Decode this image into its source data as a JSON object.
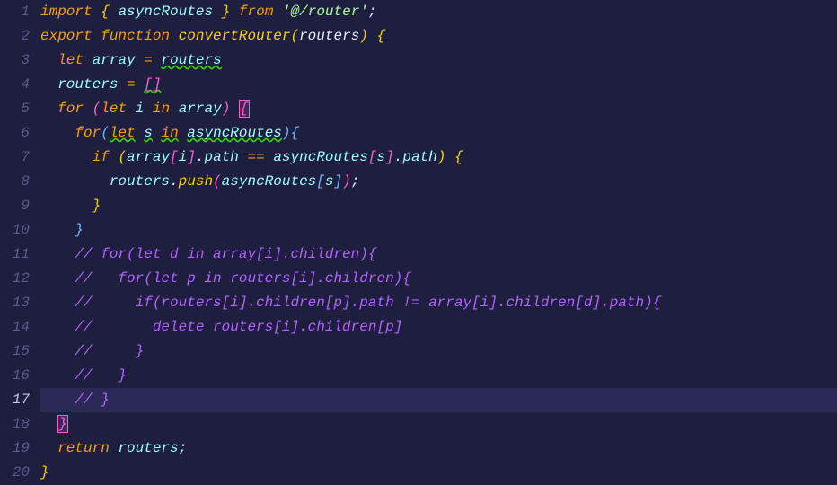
{
  "editor": {
    "activeLine": 17,
    "lines": [
      {
        "num": 1
      },
      {
        "num": 2
      },
      {
        "num": 3
      },
      {
        "num": 4
      },
      {
        "num": 5
      },
      {
        "num": 6
      },
      {
        "num": 7
      },
      {
        "num": 8
      },
      {
        "num": 9
      },
      {
        "num": 10
      },
      {
        "num": 11
      },
      {
        "num": 12
      },
      {
        "num": 13
      },
      {
        "num": 14
      },
      {
        "num": 15
      },
      {
        "num": 16
      },
      {
        "num": 17
      },
      {
        "num": 18
      },
      {
        "num": 19
      },
      {
        "num": 20
      }
    ]
  },
  "tokens": {
    "l1": {
      "import": "import",
      "lbrace": "{",
      "asyncRoutes": "asyncRoutes",
      "rbrace": "}",
      "from": "from",
      "str": "'@/router'",
      "semi": ";"
    },
    "l2": {
      "export": "export",
      "function": "function",
      "name": "convertRouter",
      "lparen": "(",
      "param": "routers",
      "rparen": ")",
      "lbrace": "{"
    },
    "l3": {
      "let": "let",
      "array": "array",
      "eq": "=",
      "routers": "routers"
    },
    "l4": {
      "routers": "routers",
      "eq": "=",
      "brackets": "[]"
    },
    "l5": {
      "for": "for",
      "lparen": "(",
      "let": "let",
      "i": "i",
      "in": "in",
      "array": "array",
      "rparen": ")",
      "lbrace": "{"
    },
    "l6": {
      "for": "for",
      "lparen": "(",
      "let": "let",
      "s": "s",
      "in": "in",
      "asyncRoutes": "asyncRoutes",
      "rparen": ")",
      "lbrace": "{"
    },
    "l7": {
      "if": "if",
      "lparen": "(",
      "array": "array",
      "lbr1": "[",
      "i": "i",
      "rbr1": "]",
      "dot1": ".",
      "path1": "path",
      "eq": "==",
      "asyncRoutes": "asyncRoutes",
      "lbr2": "[",
      "s": "s",
      "rbr2": "]",
      "dot2": ".",
      "path2": "path",
      "rparen": ")",
      "lbrace": "{"
    },
    "l8": {
      "routers": "routers",
      "dot1": ".",
      "push": "push",
      "lparen": "(",
      "asyncRoutes": "asyncRoutes",
      "lbr": "[",
      "s": "s",
      "rbr": "]",
      "rparen": ")",
      "semi": ";"
    },
    "l9": {
      "rbrace": "}"
    },
    "l10": {
      "rbrace": "}"
    },
    "l11": {
      "comment": "// for(let d in array[i].children){"
    },
    "l12": {
      "comment": "//   for(let p in routers[i].children){"
    },
    "l13": {
      "comment": "//     if(routers[i].children[p].path != array[i].children[d].path){"
    },
    "l14": {
      "comment": "//       delete routers[i].children[p]"
    },
    "l15": {
      "comment": "//     }"
    },
    "l16": {
      "comment": "//   }"
    },
    "l17": {
      "comment": "// }"
    },
    "l18": {
      "rbrace": "}"
    },
    "l19": {
      "return": "return",
      "routers": "routers",
      "semi": ";"
    },
    "l20": {
      "rbrace": "}"
    }
  }
}
